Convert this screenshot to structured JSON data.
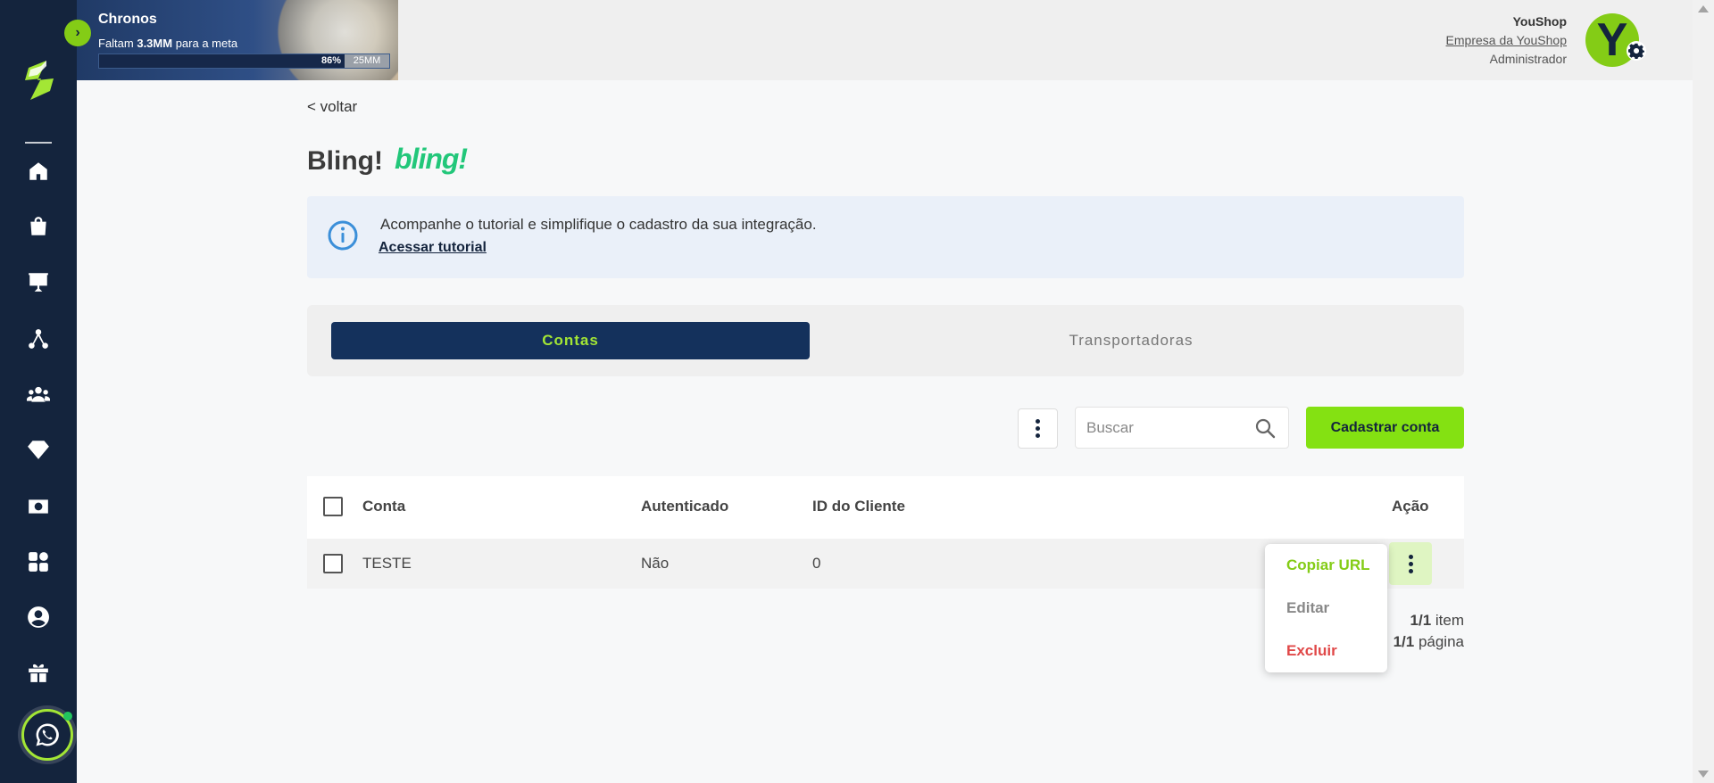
{
  "banner": {
    "title": "Chronos",
    "subtitle_prefix": "Faltam ",
    "subtitle_amount": "3.3MM",
    "subtitle_suffix": " para a meta",
    "progress_percent": 86,
    "progress_label": "86%",
    "goal_label": "25MM"
  },
  "user": {
    "name": "YouShop",
    "company": "Empresa da YouShop",
    "role": "Administrador",
    "avatar_letter": "Y"
  },
  "page": {
    "back_label": "< voltar",
    "title": "Bling!",
    "brand_logo_text": "bling!"
  },
  "info": {
    "text": "Acompanhe o tutorial e simplifique o cadastro da sua integração.",
    "link": "Acessar tutorial"
  },
  "tabs": [
    {
      "label": "Contas",
      "active": true
    },
    {
      "label": "Transportadoras",
      "active": false
    }
  ],
  "toolbar": {
    "search_placeholder": "Buscar",
    "add_button": "Cadastrar conta"
  },
  "table": {
    "headers": {
      "conta": "Conta",
      "autenticado": "Autenticado",
      "id_cliente": "ID do Cliente",
      "acao": "Ação"
    },
    "rows": [
      {
        "conta": "TESTE",
        "autenticado": "Não",
        "id_cliente": "0"
      }
    ]
  },
  "pagination": {
    "items_count": "1/1",
    "items_label": " item",
    "pages_count": "1/1",
    "pages_label": " página"
  },
  "row_menu": {
    "copy_url": "Copiar URL",
    "edit": "Editar",
    "delete": "Excluir"
  },
  "colors": {
    "sidebar": "#14243d",
    "accent_green": "#84e112",
    "active_tab": "#14315c",
    "danger": "#e04848"
  }
}
